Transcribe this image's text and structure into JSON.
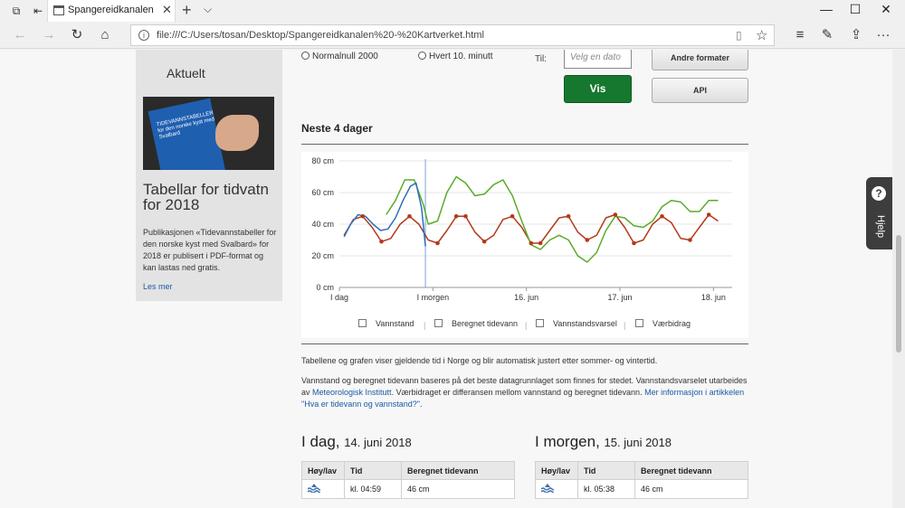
{
  "browser": {
    "tab_title": "Spangereidkanalen - Ka",
    "url": "file:///C:/Users/tosan/Desktop/Spangereidkanalen%20-%20Kartverket.html",
    "tab_close": "✕",
    "new_tab": "+",
    "tab_dropdown": "⌵",
    "window_controls": [
      "—",
      "☐",
      "✕"
    ],
    "nav_icons": {
      "back": "←",
      "forward": "→",
      "refresh": "↻",
      "home": "⌂",
      "favorites": "☆",
      "hub": "≡",
      "notes": "✎",
      "share": "⇪",
      "more": "···",
      "reader": "▯"
    }
  },
  "aside": {
    "heading": "Aktuelt",
    "book_cover_text": "TIDEVANNSTABELLER for den norske kyst med Svalbard",
    "title": "Tabellar for tidvatn for 2018",
    "text": "Publikasjonen «Tidevannstabeller for den norske kyst med Svalbard» for 2018 er publisert i PDF-format og kan lastas ned gratis.",
    "link": "Les mer"
  },
  "form": {
    "radio_1": "Normalnull 2000",
    "radio_2": "Hvert 10. minutt",
    "til_label": "Til:",
    "date_placeholder": "Velg en dato",
    "btn_formats": "Andre formater",
    "btn_vis": "Vis",
    "btn_api": "API"
  },
  "section_title": "Neste 4 dager",
  "chart_data": {
    "type": "line",
    "y_ticks": [
      "0 cm",
      "20 cm",
      "40 cm",
      "60 cm",
      "80 cm"
    ],
    "ylim": [
      0,
      80
    ],
    "x_ticks": [
      "I dag",
      "I morgen",
      "16. jun",
      "17. jun",
      "18. jun"
    ],
    "xlim": [
      0,
      4.2
    ],
    "grid": true,
    "now_x": 0.92,
    "legend": [
      "Vannstand",
      "Beregnet tidevann",
      "Vannstandsvarsel",
      "Værbidrag"
    ],
    "series": [
      {
        "color": "#b33a1a",
        "x": [
          0.05,
          0.15,
          0.25,
          0.35,
          0.45,
          0.55,
          0.65,
          0.75,
          0.85,
          0.95,
          1.05,
          1.15,
          1.25,
          1.35,
          1.45,
          1.55,
          1.65,
          1.75,
          1.85,
          1.95,
          2.05,
          2.15,
          2.25,
          2.35,
          2.45,
          2.55,
          2.65,
          2.75,
          2.85,
          2.95,
          3.05,
          3.15,
          3.25,
          3.35,
          3.45,
          3.55,
          3.65,
          3.75,
          3.85,
          3.95,
          4.05
        ],
        "y": [
          33,
          43,
          45,
          38,
          29,
          31,
          40,
          45,
          40,
          30,
          28,
          36,
          45,
          45,
          35,
          29,
          33,
          43,
          45,
          38,
          28,
          28,
          36,
          44,
          45,
          35,
          30,
          33,
          44,
          46,
          38,
          28,
          30,
          40,
          45,
          41,
          31,
          30,
          38,
          46,
          42
        ]
      },
      {
        "color": "#5aab2a",
        "x": [
          0.5,
          0.6,
          0.7,
          0.8,
          0.9,
          0.95,
          1.05,
          1.15,
          1.25,
          1.35,
          1.45,
          1.55,
          1.65,
          1.75,
          1.85,
          1.95,
          2.05,
          2.15,
          2.25,
          2.35,
          2.45,
          2.55,
          2.65,
          2.75,
          2.85,
          2.95,
          3.05,
          3.15,
          3.25,
          3.35,
          3.45,
          3.55,
          3.65,
          3.75,
          3.85,
          3.95,
          4.05
        ],
        "y": [
          46,
          55,
          68,
          68,
          52,
          40,
          42,
          60,
          70,
          66,
          58,
          59,
          65,
          68,
          58,
          42,
          27,
          24,
          30,
          33,
          30,
          20,
          16,
          22,
          36,
          45,
          44,
          39,
          38,
          42,
          51,
          55,
          54,
          48,
          48,
          55,
          55
        ]
      },
      {
        "color": "#2d6fbd",
        "x": [
          0.05,
          0.12,
          0.2,
          0.28,
          0.36,
          0.44,
          0.52,
          0.6,
          0.68,
          0.76,
          0.82,
          0.88,
          0.92
        ],
        "y": [
          32,
          40,
          46,
          45,
          40,
          36,
          37,
          44,
          55,
          64,
          66,
          50,
          26
        ]
      }
    ]
  },
  "paragraph_1": "Tabellene og grafen viser gjeldende tid i Norge og blir automatisk justert etter sommer- og vintertid.",
  "paragraph_2": {
    "text_a": "Vannstand og beregnet tidevann baseres på det beste datagrunnlaget som finnes for stedet. Vannstandsvarselet utarbeides av ",
    "link_a": "Meteorologisk Institutt",
    "text_b": ". Værbidraget er differansen mellom vannstand og beregnet tidevann. ",
    "link_b": "Mer informasjon i artikkelen \"Hva er tidevann og vannstand?\"",
    "text_c": "."
  },
  "today": {
    "title": "I dag,",
    "date": "14. juni 2018",
    "headers": [
      "Høy/lav",
      "Tid",
      "Beregnet tidevann"
    ],
    "rows": [
      {
        "time": "kl. 04:59",
        "value": "46 cm"
      }
    ]
  },
  "tomorrow": {
    "title": "I morgen,",
    "date": "15. juni 2018",
    "headers": [
      "Høy/lav",
      "Tid",
      "Beregnet tidevann"
    ],
    "rows": [
      {
        "time": "kl. 05:38",
        "value": "46 cm"
      }
    ]
  },
  "help": {
    "icon": "?",
    "label": "Hjelp"
  },
  "colors": {
    "accent_green": "#16782e",
    "link_blue": "#1a5aa6",
    "tide_red": "#b33a1a",
    "forecast_green": "#5aab2a",
    "observed_blue": "#2d6fbd"
  }
}
